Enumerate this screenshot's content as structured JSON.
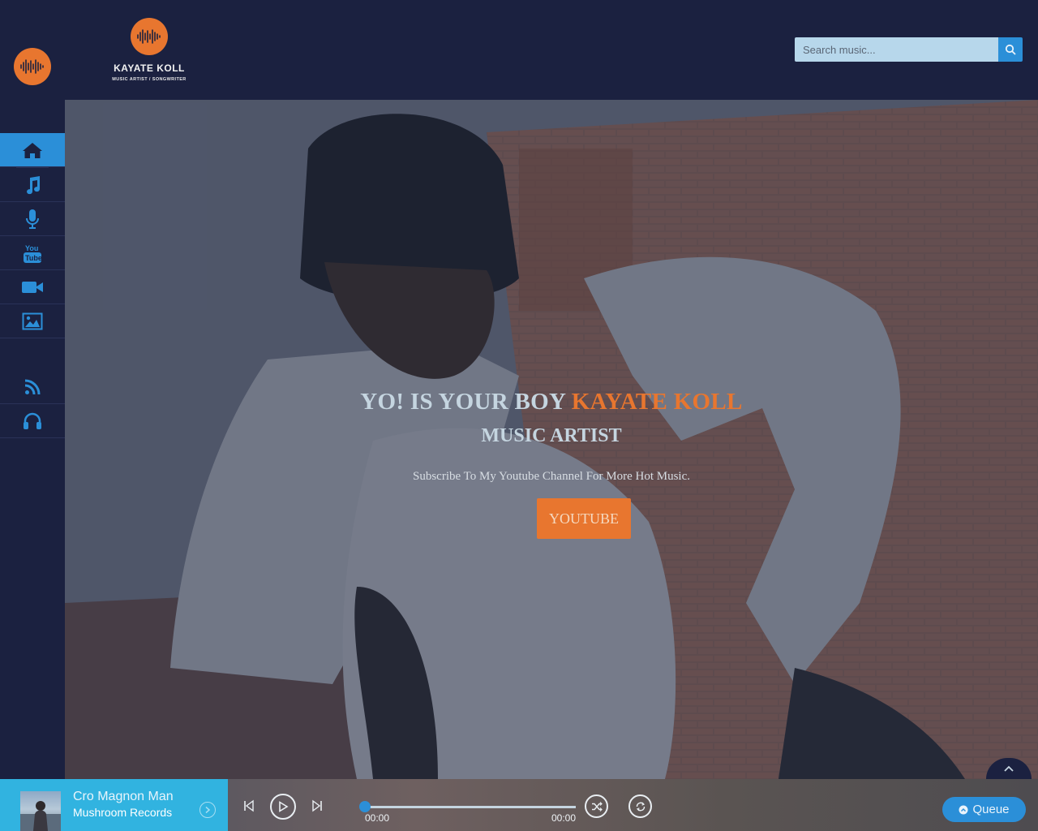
{
  "brand": {
    "name": "KAYATE KOLL",
    "tagline": "MUSIC ARTIST / SONGWRITER"
  },
  "search": {
    "placeholder": "Search music..."
  },
  "sidebar": {
    "items": [
      {
        "icon": "home-icon",
        "active": true
      },
      {
        "icon": "music-note-icon",
        "active": false
      },
      {
        "icon": "microphone-icon",
        "active": false
      },
      {
        "icon": "youtube-icon",
        "active": false
      },
      {
        "icon": "video-camera-icon",
        "active": false
      },
      {
        "icon": "image-icon",
        "active": false
      },
      {
        "icon": "rss-icon",
        "active": false
      },
      {
        "icon": "headphones-icon",
        "active": false
      }
    ]
  },
  "hero": {
    "headline_prefix": "YO! IS YOUR BOY ",
    "headline_accent": "KAYATE KOLL",
    "subheading": "MUSIC ARTIST",
    "tagline": "Subscribe To My Youtube Channel For More Hot Music.",
    "button_label": "YOUTUBE"
  },
  "player": {
    "track_title": "Cro Magnon Man",
    "track_artist": "Mushroom Records",
    "time_current": "00:00",
    "time_total": "00:00",
    "progress": 0,
    "queue_label": "Queue"
  },
  "colors": {
    "accent": "#e8762f",
    "primary": "#2b8fd8",
    "background": "#1b2140",
    "player_now": "#31b3e0"
  }
}
